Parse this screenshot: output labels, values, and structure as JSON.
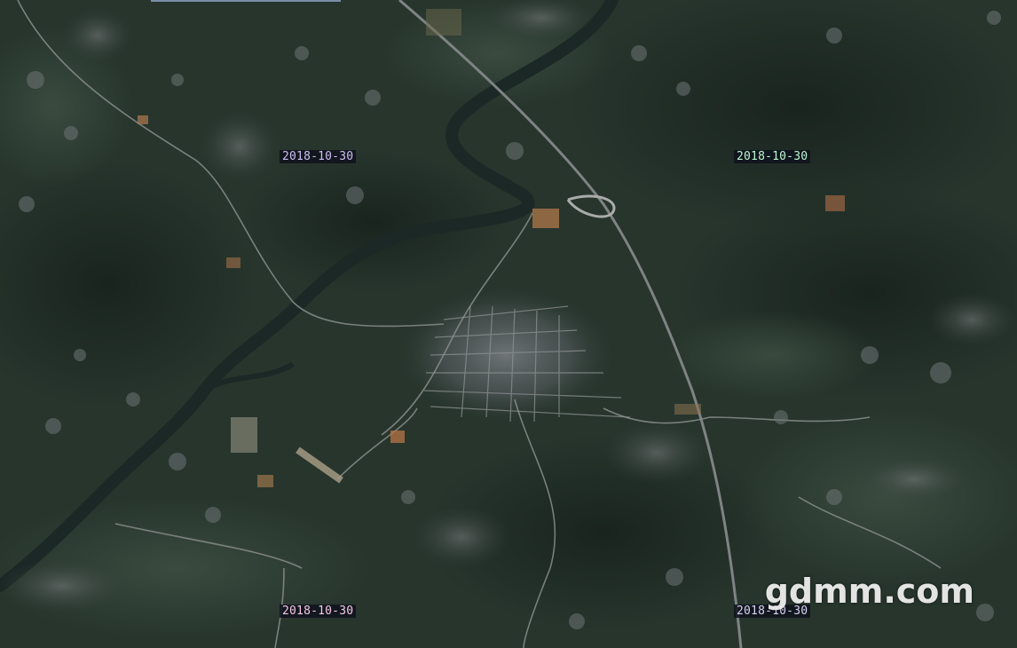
{
  "map": {
    "type": "satellite imagery tile mosaic",
    "tiles": [
      {
        "date": "2018-10-30",
        "label_color": "#cdbdf2"
      },
      {
        "date": "2018-10-30",
        "label_color": "#b9f7cf"
      },
      {
        "date": "2018-10-30",
        "label_color": "#f5c8e6"
      },
      {
        "date": "2018-10-30",
        "label_color": "#d9d2f5"
      }
    ],
    "watermark": "gdmm.com",
    "colors": {
      "vegetation_dark": "#1e2b24",
      "vegetation": "#2b3b30",
      "river": "#1a2a2a",
      "urban": "#6e7377",
      "road": "#8c8f8f",
      "bare_soil": "#b07a4e"
    }
  }
}
